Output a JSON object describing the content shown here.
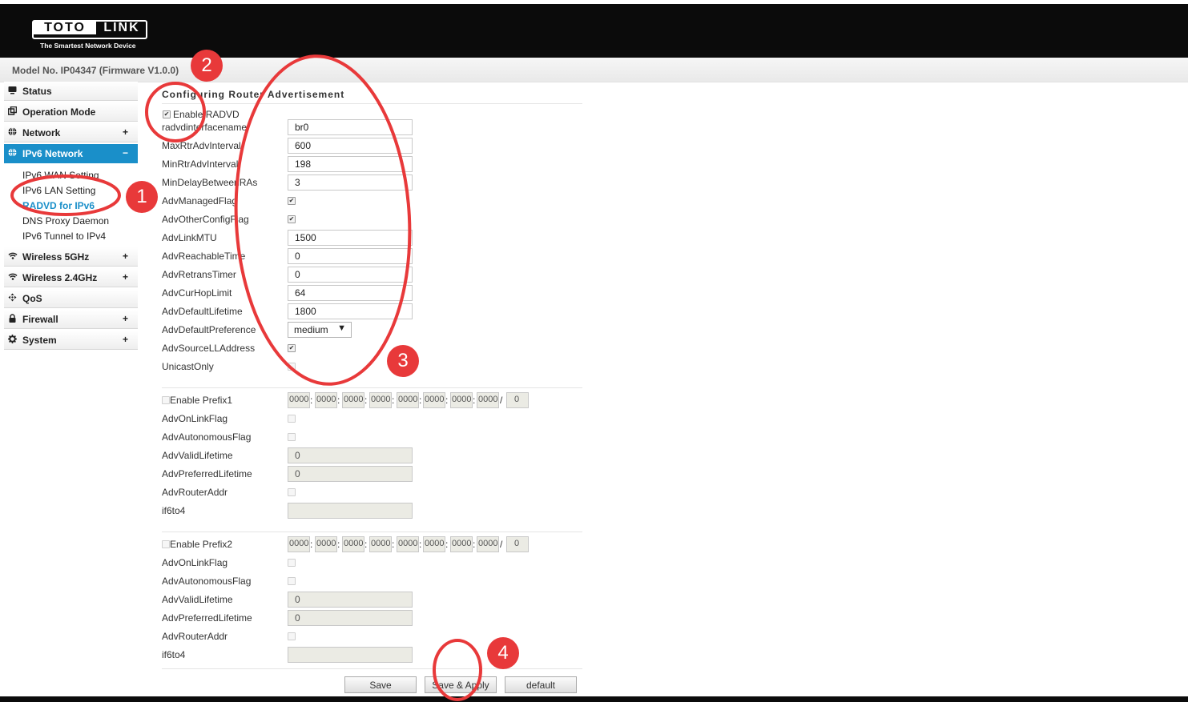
{
  "header": {
    "logo_left": "TOTO",
    "logo_right": "LINK",
    "tagline": "The Smartest Network Device",
    "bg_color": "#0b0b0b"
  },
  "model_text": "Model No. IP04347 (Firmware V1.0.0)",
  "accent_color": "#1a8fc9",
  "sidebar": {
    "items": [
      {
        "label": "Status",
        "icon": "status-icon",
        "expander": ""
      },
      {
        "label": "Operation Mode",
        "icon": "operation-mode-icon",
        "expander": ""
      },
      {
        "label": "Network",
        "icon": "globe-icon",
        "expander": "+"
      },
      {
        "label": "IPv6 Network",
        "icon": "globe-icon",
        "expander": "−"
      },
      {
        "label": "Wireless 5GHz",
        "icon": "wifi-icon",
        "expander": "+"
      },
      {
        "label": "Wireless 2.4GHz",
        "icon": "wifi-icon",
        "expander": "+"
      },
      {
        "label": "QoS",
        "icon": "qos-icon",
        "expander": ""
      },
      {
        "label": "Firewall",
        "icon": "lock-icon",
        "expander": "+"
      },
      {
        "label": "System",
        "icon": "gear-icon",
        "expander": "+"
      }
    ],
    "ipv6_submenu": [
      "IPv6 WAN Setting",
      "IPv6 LAN Setting",
      "RADVD for IPv6",
      "DNS Proxy Daemon",
      "IPv6 Tunnel to IPv4"
    ]
  },
  "content": {
    "title": "Configuring Router Advertisement",
    "enable_radvd_label": "Enable RADVD",
    "fields": {
      "radvdinterfacename": {
        "label": "radvdinterfacename",
        "value": "br0"
      },
      "maxrtr": {
        "label": "MaxRtrAdvInterval",
        "value": "600"
      },
      "minrtr": {
        "label": "MinRtrAdvInterval",
        "value": "198"
      },
      "mindelay": {
        "label": "MinDelayBetweenRAs",
        "value": "3"
      },
      "managed": {
        "label": "AdvManagedFlag"
      },
      "otherconfig": {
        "label": "AdvOtherConfigFlag"
      },
      "linkmtu": {
        "label": "AdvLinkMTU",
        "value": "1500"
      },
      "reachable": {
        "label": "AdvReachableTime",
        "value": "0"
      },
      "retrans": {
        "label": "AdvRetransTimer",
        "value": "0"
      },
      "curhop": {
        "label": "AdvCurHopLimit",
        "value": "64"
      },
      "deflife": {
        "label": "AdvDefaultLifetime",
        "value": "1800"
      },
      "defpref": {
        "label": "AdvDefaultPreference",
        "value": "medium"
      },
      "sourcell": {
        "label": "AdvSourceLLAddress"
      },
      "unicast": {
        "label": "UnicastOnly"
      }
    },
    "prefix1": {
      "label": "Enable Prefix1",
      "segments": [
        "0000",
        "0000",
        "0000",
        "0000",
        "0000",
        "0000",
        "0000",
        "0000"
      ],
      "colon": ":",
      "slash": "/",
      "length": "0",
      "onlink": "AdvOnLinkFlag",
      "autonomous": "AdvAutonomousFlag",
      "valid": {
        "label": "AdvValidLifetime",
        "value": "0"
      },
      "preferred": {
        "label": "AdvPreferredLifetime",
        "value": "0"
      },
      "routeraddr": "AdvRouterAddr",
      "if6to4": {
        "label": "if6to4",
        "value": ""
      }
    },
    "prefix2": {
      "label": "Enable Prefix2",
      "segments": [
        "0000",
        "0000",
        "0000",
        "0000",
        "0000",
        "0000",
        "0000",
        "0000"
      ],
      "colon": ":",
      "slash": "/",
      "length": "0",
      "onlink": "AdvOnLinkFlag",
      "autonomous": "AdvAutonomousFlag",
      "valid": {
        "label": "AdvValidLifetime",
        "value": "0"
      },
      "preferred": {
        "label": "AdvPreferredLifetime",
        "value": "0"
      },
      "routeraddr": "AdvRouterAddr",
      "if6to4": {
        "label": "if6to4",
        "value": ""
      }
    },
    "buttons": {
      "save": "Save",
      "save_apply": "Save & Apply",
      "default": "default"
    }
  },
  "annotations": {
    "color": "#e8393a",
    "badges": [
      "1",
      "2",
      "3",
      "4"
    ]
  }
}
